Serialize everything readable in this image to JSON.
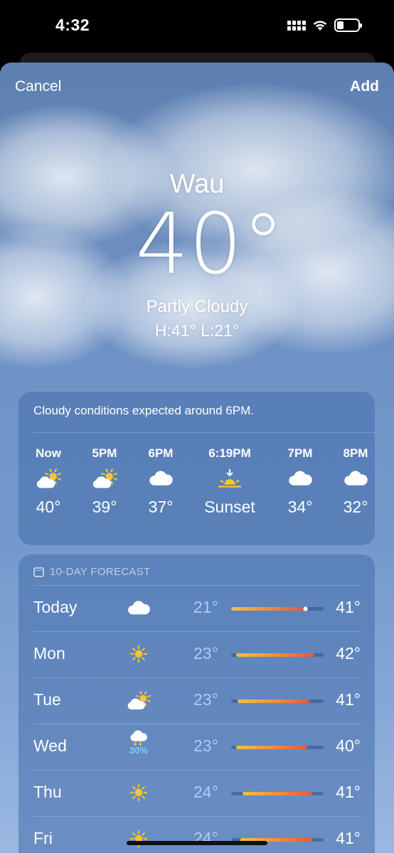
{
  "status_bar": {
    "time": "4:32"
  },
  "nav": {
    "cancel_label": "Cancel",
    "add_label": "Add"
  },
  "current": {
    "city": "Wau",
    "temperature": "40°",
    "condition": "Partly Cloudy",
    "high_low": "H:41°  L:21°"
  },
  "hourly": {
    "summary": "Cloudy conditions expected around 6PM.",
    "items": [
      {
        "label": "Now",
        "icon": "partly-cloudy-icon",
        "value": "40°"
      },
      {
        "label": "5PM",
        "icon": "partly-cloudy-icon",
        "value": "39°"
      },
      {
        "label": "6PM",
        "icon": "cloud-icon",
        "value": "37°"
      },
      {
        "label": "6:19PM",
        "icon": "sunset-icon",
        "value": "Sunset"
      },
      {
        "label": "7PM",
        "icon": "cloud-icon",
        "value": "34°"
      },
      {
        "label": "8PM",
        "icon": "cloud-icon",
        "value": "32°"
      }
    ]
  },
  "forecast": {
    "header": "10-DAY FORECAST",
    "days": [
      {
        "day": "Today",
        "icon": "cloud-icon",
        "precip": "",
        "low": "21°",
        "high": "41°",
        "bar_start": 0.0,
        "bar_end": 0.78,
        "current_marker": 0.8
      },
      {
        "day": "Mon",
        "icon": "sun-icon",
        "precip": "",
        "low": "23°",
        "high": "42°",
        "bar_start": 0.05,
        "bar_end": 0.9
      },
      {
        "day": "Tue",
        "icon": "partly-cloudy-icon",
        "precip": "",
        "low": "23°",
        "high": "41°",
        "bar_start": 0.07,
        "bar_end": 0.85
      },
      {
        "day": "Wed",
        "icon": "thunderstorm-icon",
        "precip": "30%",
        "low": "23°",
        "high": "40°",
        "bar_start": 0.05,
        "bar_end": 0.82
      },
      {
        "day": "Thu",
        "icon": "sun-icon",
        "precip": "",
        "low": "24°",
        "high": "41°",
        "bar_start": 0.12,
        "bar_end": 0.88
      },
      {
        "day": "Fri",
        "icon": "sun-icon",
        "precip": "",
        "low": "24°",
        "high": "41°",
        "bar_start": 0.1,
        "bar_end": 0.88
      }
    ]
  },
  "colors": {
    "sun": "#f7c531",
    "precip": "#7fd0ff"
  }
}
